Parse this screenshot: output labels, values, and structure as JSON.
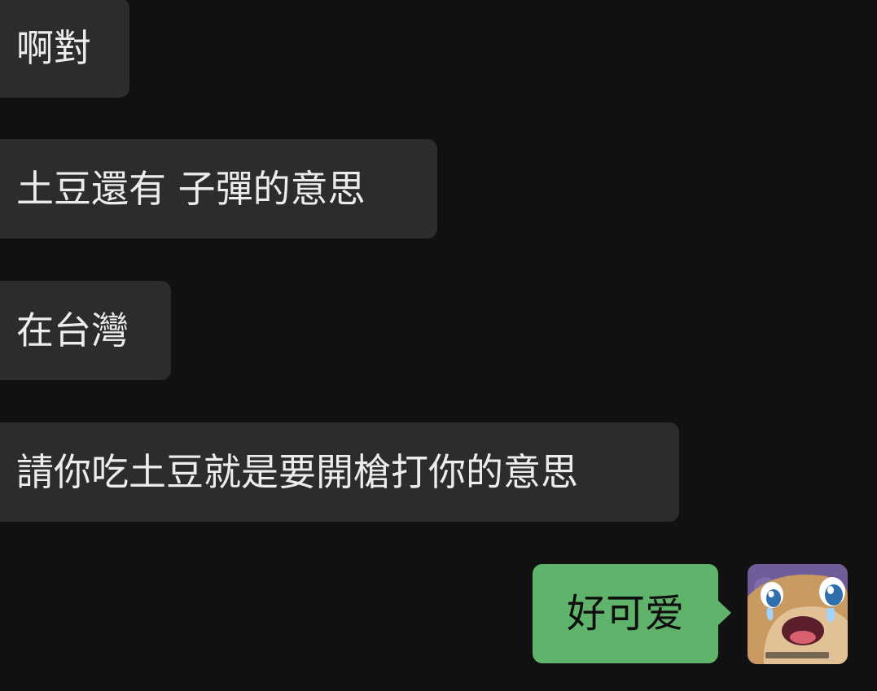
{
  "messages": [
    {
      "direction": "incoming",
      "text": "啊對"
    },
    {
      "direction": "incoming",
      "text": "土豆還有 子彈的意思"
    },
    {
      "direction": "incoming",
      "text": "在台灣"
    },
    {
      "direction": "incoming",
      "text": "請你吃土豆就是要開槍打你的意思"
    },
    {
      "direction": "outgoing",
      "text": "好可爱"
    }
  ],
  "self_avatar": {
    "icon": "crying-cartoon-avatar-icon"
  },
  "colors": {
    "background": "#111111",
    "incoming_bubble": "#2c2c2c",
    "incoming_text": "#ececec",
    "outgoing_bubble": "#5fb36b",
    "outgoing_text": "#0e0e0e"
  }
}
